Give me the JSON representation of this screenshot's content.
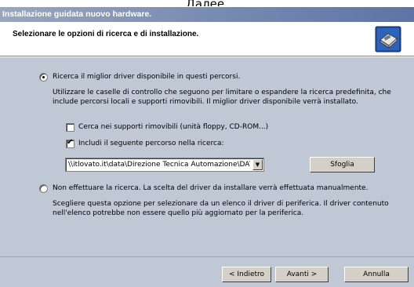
{
  "crop_text": "Далее.",
  "window": {
    "title": "Installazione guidata nuovo hardware."
  },
  "header": {
    "title": "Selezionare le opzioni di ricerca e di installazione.",
    "icon": "hardware-wizard-icon"
  },
  "options": {
    "search": {
      "label": "Ricerca il miglior driver disponibile in questi percorsi.",
      "selected": true,
      "description": "Utilizzare le caselle di controllo che seguono per limitare o espandere la ricerca predefinita, che include percorsi locali e supporti rimovibili. Il miglior driver disponibile verrà installato.",
      "removable": {
        "label": "Cerca nei supporti rimovibili (unità floppy, CD-ROM...)",
        "checked": false
      },
      "include_path": {
        "label": "Includi il seguente percorso nella ricerca:",
        "checked": true
      },
      "path_value": "\\\\itlovato.it\\data\\Direzione Tecnica Automazione\\DATI\\N",
      "browse_label": "Sfoglia"
    },
    "manual": {
      "label": "Non effettuare la ricerca. La scelta del driver da installare verrà effettuata manualmente.",
      "selected": false,
      "description": "Scegliere questa opzione per selezionare da un elenco il driver di periferica. Il driver contenuto nell'elenco potrebbe non essere quello più aggiornato per la periferica."
    }
  },
  "buttons": {
    "back": "< Indietro",
    "next": "Avanti >",
    "cancel": "Annulla"
  }
}
